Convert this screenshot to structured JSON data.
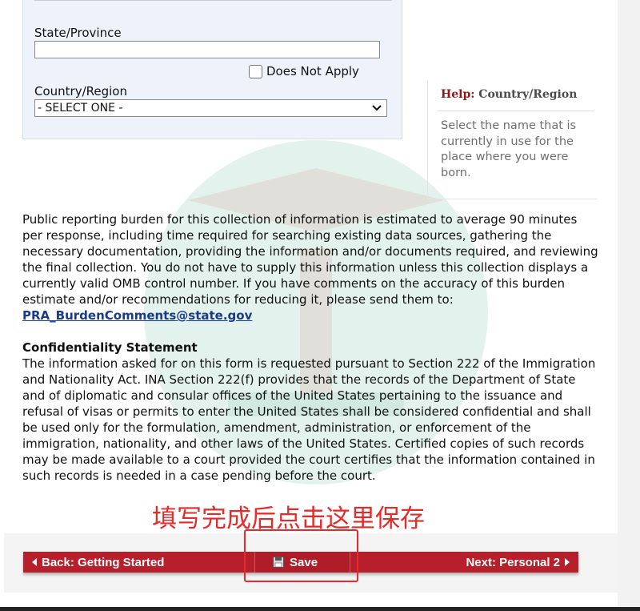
{
  "address": {
    "state_label": "State/Province",
    "state_value": "",
    "does_not_apply_label": "Does Not Apply",
    "country_label": "Country/Region",
    "country_selected": "- SELECT ONE -"
  },
  "help": {
    "prefix": "Help:",
    "topic": "Country/Region",
    "body": "Select the name that is currently in use for the place where you were born."
  },
  "burden": {
    "text": "Public reporting burden for this collection of information is estimated to average 90 minutes per response, including time required for searching existing data sources, gathering the necessary documentation, providing the information and/or documents required, and reviewing the final collection. You do not have to supply this information unless this collection displays a currently valid OMB control number. If you have comments on the accuracy of this burden estimate and/or recommendations for reducing it, please send them to: ",
    "email": "PRA_BurdenComments@state.gov"
  },
  "confidentiality": {
    "heading": "Confidentiality Statement",
    "text": "The information asked for on this form is requested pursuant to Section 222 of the Immigration and Nationality Act. INA Section 222(f) provides that the records of the Department of State and of diplomatic and consular offices of the United States pertaining to the issuance and refusal of visas or permits to enter the United States shall be considered confidential and shall be used only for the formulation, amendment, administration, or enforcement of the immigration, nationality, and other laws of the United States. Certified copies of such records may be made available to a court provided the court certifies that the information contained in such records is needed in a case pending before the court."
  },
  "annotation": "填写完成后点击这里保存",
  "nav": {
    "back_label": "Back: Getting Started",
    "save_label": "Save",
    "next_label": "Next: Personal 2"
  },
  "colors": {
    "nav_red": "#b71f2a",
    "annotation_red": "#e52a2a",
    "help_title": "#8a1a1a",
    "link": "#1a3a8a",
    "panel_bg": "#eef2fa"
  },
  "icons": {
    "dropdown": "chevron-down-icon",
    "save": "floppy-disk-icon",
    "back": "triangle-left-icon",
    "next": "triangle-right-icon"
  }
}
